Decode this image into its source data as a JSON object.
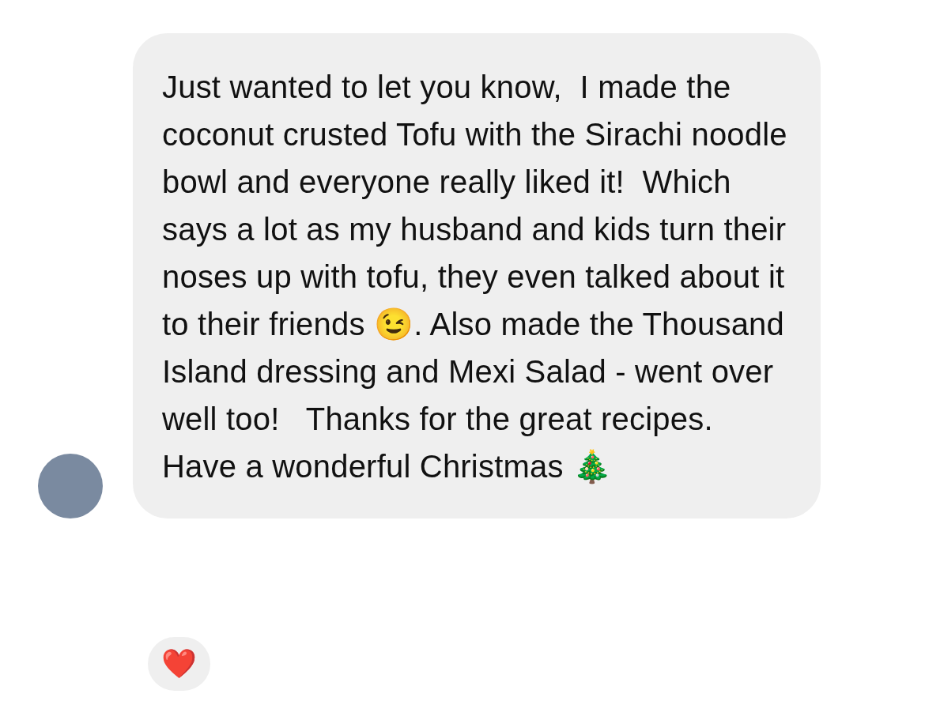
{
  "message": {
    "text": "Just wanted to let you know,  I made the coconut crusted Tofu with the Sirachi noodle bowl and everyone really liked it!  Which says a lot as my husband and kids turn their noses up with tofu, they even talked about it to their friends 😉. Also made the Thousand Island dressing and Mexi Salad - went over well too!   Thanks for the great recipes.  Have a wonderful Christmas 🎄",
    "reactions": [
      {
        "emoji": "❤️"
      }
    ]
  }
}
